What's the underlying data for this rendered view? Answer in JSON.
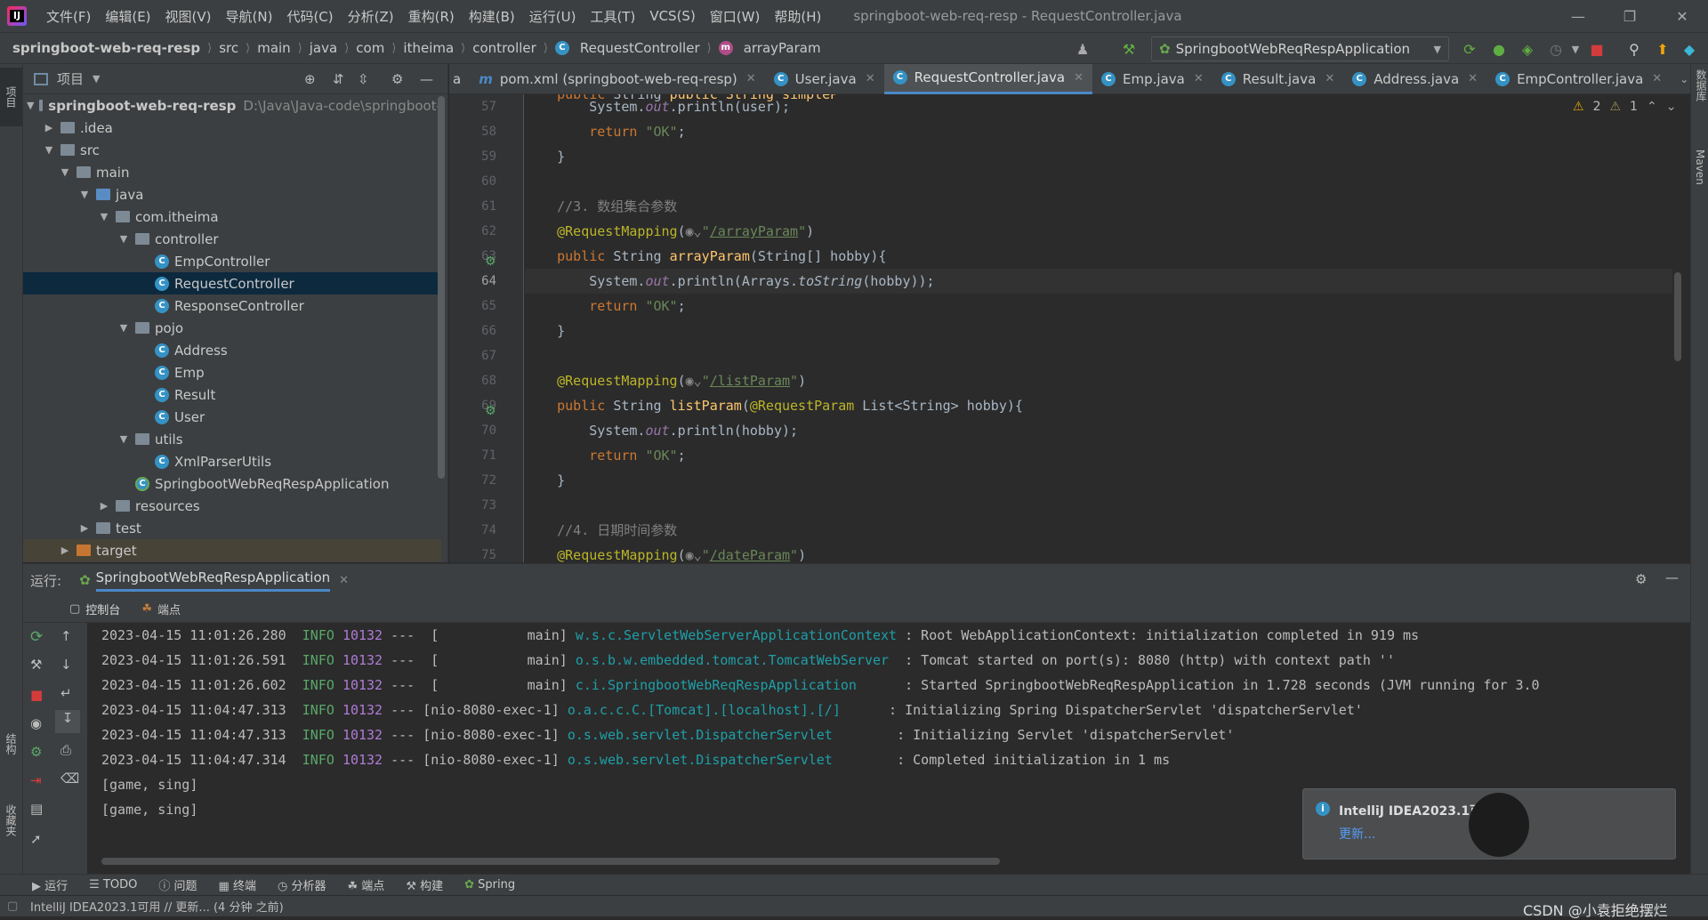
{
  "menu": [
    "文件(F)",
    "编辑(E)",
    "视图(V)",
    "导航(N)",
    "代码(C)",
    "分析(Z)",
    "重构(R)",
    "构建(B)",
    "运行(U)",
    "工具(T)",
    "VCS(S)",
    "窗口(W)",
    "帮助(H)"
  ],
  "window_title": "springboot-web-req-resp - RequestController.java",
  "breadcrumb": [
    "springboot-web-req-resp",
    "src",
    "main",
    "java",
    "com",
    "itheima",
    "controller",
    "RequestController",
    "arrayParam"
  ],
  "run_config": "SpringbootWebReqRespApplication",
  "left_stripe": {
    "project": "项目",
    "structure": "结构",
    "favorites": "收藏夹"
  },
  "right_stripe": {
    "database": "数据库",
    "maven": "Maven"
  },
  "project_panel": {
    "title": "项目",
    "root_name": "springboot-web-req-resp",
    "root_path": "D:\\Java\\Java-code\\springboot-",
    "items": [
      ".idea",
      "src",
      "main",
      "java",
      "com.itheima",
      "controller",
      "EmpController",
      "RequestController",
      "ResponseController",
      "pojo",
      "Address",
      "Emp",
      "Result",
      "User",
      "utils",
      "XmlParserUtils",
      "SpringbootWebReqRespApplication",
      "resources",
      "test",
      "target"
    ]
  },
  "tabs": [
    "a",
    "pom.xml (springboot-web-req-resp)",
    "User.java",
    "RequestController.java",
    "Emp.java",
    "Result.java",
    "Address.java",
    "EmpController.java"
  ],
  "inspections": {
    "warnings": "2",
    "weak": "1"
  },
  "line_numbers": [
    "57",
    "58",
    "59",
    "60",
    "61",
    "62",
    "63",
    "64",
    "65",
    "66",
    "67",
    "68",
    "69",
    "70",
    "71",
    "72",
    "73",
    "74",
    "75"
  ],
  "code": {
    "l56_frag": "public String simpleP",
    "comment_array": "//3. 数组集合参数",
    "comment_date": "//4. 日期时间参数",
    "array_path": "/arrayParam",
    "list_path": "/listParam",
    "date_path": "/dateParam"
  },
  "run_panel": {
    "label": "运行:",
    "app": "SpringbootWebReqRespApplication",
    "console_tab": "控制台",
    "endpoints_tab": "端点",
    "logs": [
      {
        "ts": "2023-04-15 11:01:26.280",
        "level": "INFO",
        "pid": "10132",
        "thread": "---  [           main]",
        "logger": "w.s.c.ServletWebServerApplicationContext",
        "msg": " : Root WebApplicationContext: initialization completed in 919 ms"
      },
      {
        "ts": "2023-04-15 11:01:26.591",
        "level": "INFO",
        "pid": "10132",
        "thread": "---  [           main]",
        "logger": "o.s.b.w.embedded.tomcat.TomcatWebServer ",
        "msg": " : Tomcat started on port(s): 8080 (http) with context path ''"
      },
      {
        "ts": "2023-04-15 11:01:26.602",
        "level": "INFO",
        "pid": "10132",
        "thread": "---  [           main]",
        "logger": "c.i.SpringbootWebReqRespApplication     ",
        "msg": " : Started SpringbootWebReqRespApplication in 1.728 seconds (JVM running for 3.0"
      },
      {
        "ts": "2023-04-15 11:04:47.313",
        "level": "INFO",
        "pid": "10132",
        "thread": "--- [nio-8080-exec-1]",
        "logger": "o.a.c.c.C.[Tomcat].[localhost].[/]     ",
        "msg": " : Initializing Spring DispatcherServlet 'dispatcherServlet'"
      },
      {
        "ts": "2023-04-15 11:04:47.313",
        "level": "INFO",
        "pid": "10132",
        "thread": "--- [nio-8080-exec-1]",
        "logger": "o.s.web.servlet.DispatcherServlet       ",
        "msg": " : Initializing Servlet 'dispatcherServlet'"
      },
      {
        "ts": "2023-04-15 11:04:47.314",
        "level": "INFO",
        "pid": "10132",
        "thread": "--- [nio-8080-exec-1]",
        "logger": "o.s.web.servlet.DispatcherServlet       ",
        "msg": " : Completed initialization in 1 ms"
      }
    ],
    "output": [
      "[game, sing]",
      "[game, sing]"
    ]
  },
  "bottom_tools": [
    "运行",
    "TODO",
    "问题",
    "终端",
    "分析器",
    "端点",
    "构建",
    "Spring"
  ],
  "status": "IntelliJ IDEA2023.1可用 // 更新... (4 分钟 之前)",
  "notification": {
    "title": "IntelliJ IDEA2023.1可用",
    "link": "更新..."
  },
  "watermark": "CSDN @小袁拒绝摆烂",
  "colors": {
    "accent": "#4a88c7",
    "keyword": "#cc7832",
    "string": "#6a8759",
    "annotation": "#bbb529",
    "logger": "#1e9fa8",
    "info": "#59a869"
  }
}
